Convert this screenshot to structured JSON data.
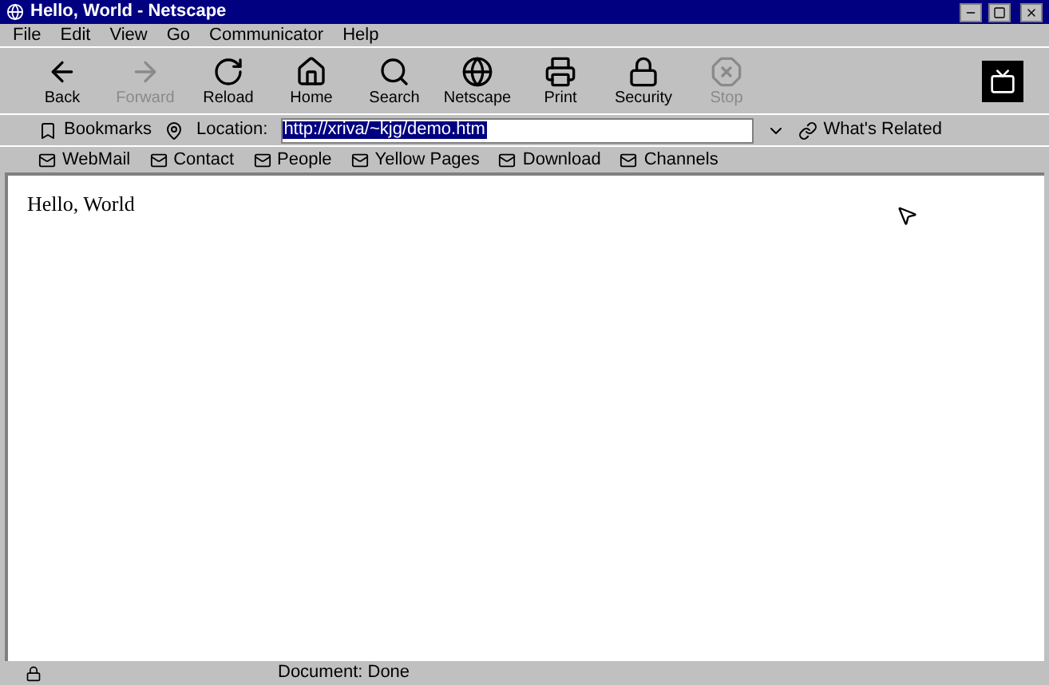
{
  "window": {
    "title": "Hello, World - Netscape"
  },
  "menu": [
    "File",
    "Edit",
    "View",
    "Go",
    "Communicator",
    "Help"
  ],
  "toolbar": [
    {
      "label": "Back",
      "disabled": false
    },
    {
      "label": "Forward",
      "disabled": true
    },
    {
      "label": "Reload",
      "disabled": false
    },
    {
      "label": "Home",
      "disabled": false
    },
    {
      "label": "Search",
      "disabled": false
    },
    {
      "label": "Netscape",
      "disabled": false
    },
    {
      "label": "Print",
      "disabled": false
    },
    {
      "label": "Security",
      "disabled": false
    },
    {
      "label": "Stop",
      "disabled": true
    }
  ],
  "location": {
    "bookmarks": "Bookmarks",
    "label": "Location:",
    "value": "http://xriva/~kjg/demo.htm",
    "related": "What's Related"
  },
  "personal": [
    "WebMail",
    "Contact",
    "People",
    "Yellow Pages",
    "Download",
    "Channels"
  ],
  "content": {
    "text": "Hello, World"
  },
  "status_bar": {
    "text": "Document: Done"
  }
}
